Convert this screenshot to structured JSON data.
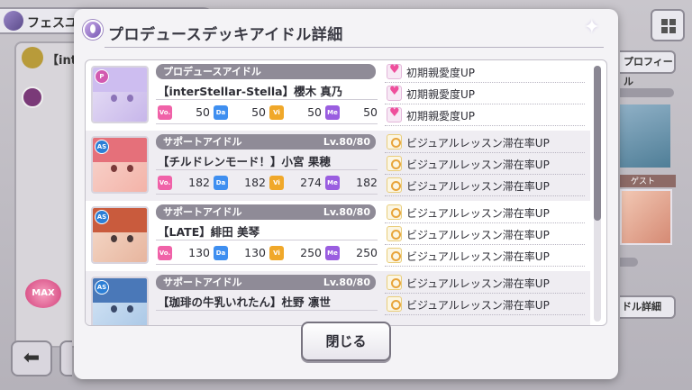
{
  "background": {
    "header_title": "フェスユ",
    "left_panel_title": "【int",
    "max_badge": "MAX",
    "back_arrow": "⬅",
    "profile_button": "プロフィール",
    "guest_label": "ゲスト",
    "detail_button": "ドル詳細"
  },
  "modal": {
    "title": "プロデュースデッキアイドル詳細",
    "close_label": "閉じる"
  },
  "idols": [
    {
      "role": "プロデュースアイドル",
      "level": "",
      "type": "pro",
      "name": "【interStellar-Stella】櫻木 真乃",
      "stats": {
        "vo": "50",
        "da": "50",
        "vi": "50",
        "me": "50"
      },
      "skills": [
        "初期親愛度UP",
        "初期親愛度UP",
        "初期親愛度UP"
      ],
      "skill_icon": "heart"
    },
    {
      "role": "サポートアイドル",
      "level": "Lv.80/80",
      "type": "sup",
      "name": "【チルドレンモード！】小宮 果穂",
      "stats": {
        "vo": "182",
        "da": "182",
        "vi": "274",
        "me": "182"
      },
      "skills": [
        "ビジュアルレッスン滞在率UP",
        "ビジュアルレッスン滞在率UP",
        "ビジュアルレッスン滞在率UP"
      ],
      "skill_icon": "visual"
    },
    {
      "role": "サポートアイドル",
      "level": "Lv.80/80",
      "type": "sup",
      "name": "【LATE】緋田 美琴",
      "stats": {
        "vo": "130",
        "da": "130",
        "vi": "250",
        "me": "250"
      },
      "skills": [
        "ビジュアルレッスン滞在率UP",
        "ビジュアルレッスン滞在率UP",
        "ビジュアルレッスン滞在率UP"
      ],
      "skill_icon": "visual"
    },
    {
      "role": "サポートアイドル",
      "level": "Lv.80/80",
      "type": "sup",
      "name": "【珈琲の牛乳いれたん】杜野 凛世",
      "stats": {
        "vo": "",
        "da": "",
        "vi": "",
        "me": ""
      },
      "skills": [
        "ビジュアルレッスン滞在率UP",
        "ビジュアルレッスン滞在率UP",
        ""
      ],
      "skill_icon": "visual"
    }
  ],
  "stat_labels": {
    "vo": "Vo.",
    "da": "Da",
    "vi": "Vi",
    "me": "Me"
  },
  "type_labels": {
    "pro": "P",
    "sup": "AS"
  },
  "colors": {
    "vocal": "#f062a8",
    "dance": "#3f8ff0",
    "visual": "#f0a82a",
    "mental": "#9a5ee0",
    "accent": "#8f8b97"
  }
}
